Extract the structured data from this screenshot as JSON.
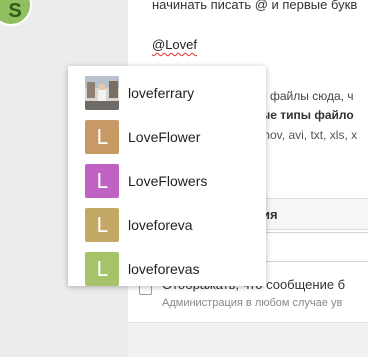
{
  "composer": {
    "hint_text": "начинать писать @ и первые букв",
    "typed_text": "@Lovef"
  },
  "attachments": {
    "drop_text": "е файлы сюда, ч",
    "types_text": "ые типы файло",
    "formats_text": "mov, avi, txt, xls, x"
  },
  "section": {
    "title": "ия"
  },
  "options": {
    "checkbox_label": "Отображать, что сообщение б",
    "checkbox_sub": "Администрация в любом случае ув"
  },
  "mention_suggestions": [
    {
      "name": "loveferrary",
      "avatar_type": "photo",
      "avatar_letter": "",
      "avatar_color": "#c9c3bd"
    },
    {
      "name": "LoveFlower",
      "avatar_type": "letter",
      "avatar_letter": "L",
      "avatar_color": "#c79a65"
    },
    {
      "name": "LoveFlowers",
      "avatar_type": "letter",
      "avatar_letter": "L",
      "avatar_color": "#c062c4"
    },
    {
      "name": "loveforeva",
      "avatar_type": "letter",
      "avatar_letter": "L",
      "avatar_color": "#c4a964"
    },
    {
      "name": "loveforevas",
      "avatar_type": "letter",
      "avatar_letter": "L",
      "avatar_color": "#a6c36a"
    }
  ],
  "user_badge": {
    "icon": "user-badge-icon",
    "color": "#8fbf5e"
  }
}
